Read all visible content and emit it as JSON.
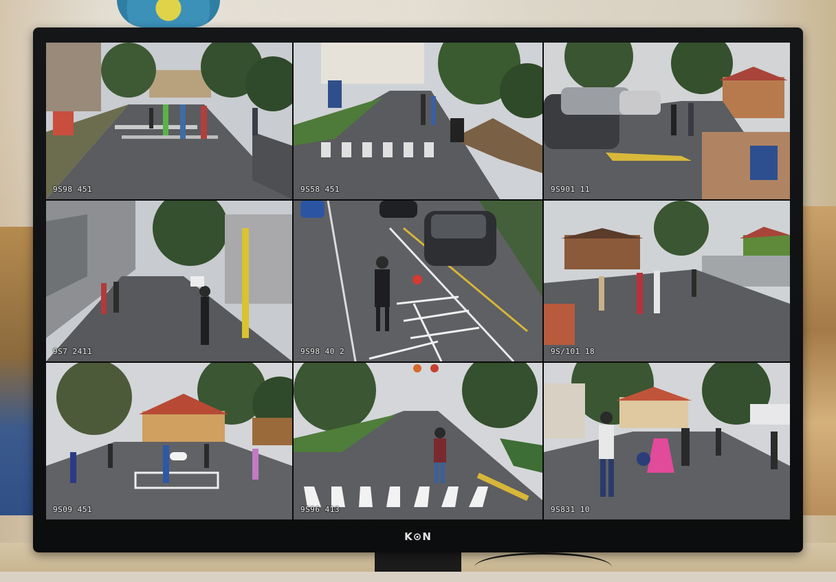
{
  "monitor": {
    "brand": "K⊙N"
  },
  "cameras": [
    {
      "timestamp": "9S98 451"
    },
    {
      "timestamp": "9S58 451"
    },
    {
      "timestamp": "9S901 11"
    },
    {
      "timestamp": "9S7 2411"
    },
    {
      "timestamp": "9S98 40 2"
    },
    {
      "timestamp": "9S/101 18"
    },
    {
      "timestamp": "9S09 451"
    },
    {
      "timestamp": "9S96 413"
    },
    {
      "timestamp": "9S831 10"
    }
  ]
}
